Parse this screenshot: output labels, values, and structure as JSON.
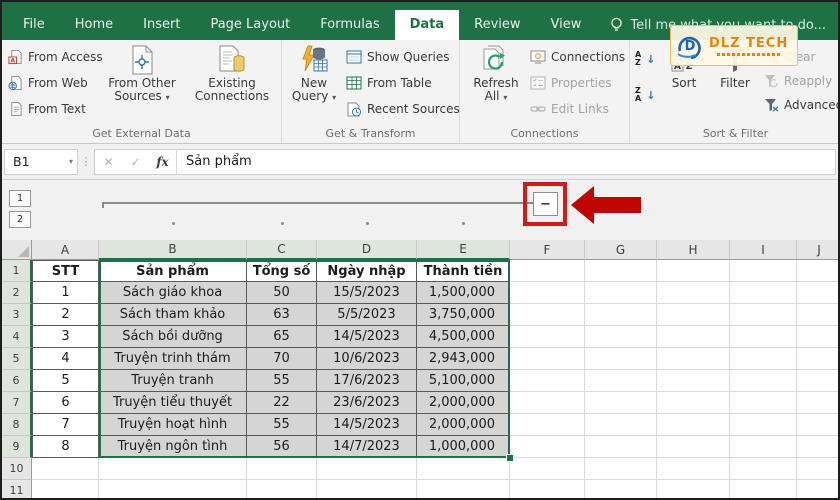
{
  "ribbon": {
    "tabs": [
      "File",
      "Home",
      "Insert",
      "Page Layout",
      "Formulas",
      "Data",
      "Review",
      "View"
    ],
    "active_tab": "Data",
    "tell_me": "Tell me what you want to do...",
    "group_labels": [
      "Get External Data",
      "Get & Transform",
      "Connections",
      "Sort & Filter"
    ],
    "buttons": {
      "from_access": "From Access",
      "from_web": "From Web",
      "from_text": "From Text",
      "from_other_sources": "From Other Sources",
      "existing_connections": "Existing Connections",
      "new_query": "New Query",
      "show_queries": "Show Queries",
      "from_table": "From Table",
      "recent_sources": "Recent Sources",
      "refresh_all": "Refresh All",
      "connections": "Connections",
      "properties": "Properties",
      "edit_links": "Edit Links",
      "sort": "Sort",
      "filter": "Filter",
      "clear": "Clear",
      "reapply": "Reapply",
      "advanced": "Advanced"
    }
  },
  "formula_bar": {
    "cell_ref": "B1",
    "formula": "Sản phẩm"
  },
  "icons": {
    "dropdown": "▾",
    "cancel": "✕",
    "enter": "✓",
    "fx": "fx",
    "more": "⋮",
    "collapse": "−",
    "sort_arrow": "↓"
  },
  "outline": {
    "level_buttons": [
      "1",
      "2"
    ]
  },
  "watermark": {
    "text": "DLZ TECH"
  },
  "sheet": {
    "column_headers": [
      "A",
      "B",
      "C",
      "D",
      "E",
      "F",
      "G",
      "H",
      "I",
      "J"
    ],
    "row_headers": [
      "1",
      "2",
      "3",
      "4",
      "5",
      "6",
      "7",
      "8",
      "9",
      "10",
      "11"
    ],
    "selection": {
      "active_cell": "B1",
      "range": "B1:E9"
    },
    "rows": [
      [
        "STT",
        "Sản phẩm",
        "Tổng số",
        "Ngày nhập",
        "Thành tiền"
      ],
      [
        "1",
        "Sách giáo khoa",
        "50",
        "15/5/2023",
        "1,500,000"
      ],
      [
        "2",
        "Sách tham khảo",
        "63",
        "5/5/2023",
        "3,750,000"
      ],
      [
        "3",
        "Sách bồi dưỡng",
        "65",
        "14/5/2023",
        "4,500,000"
      ],
      [
        "4",
        "Truyện trinh thám",
        "70",
        "10/6/2023",
        "2,943,000"
      ],
      [
        "5",
        "Truyện tranh",
        "55",
        "17/6/2023",
        "5,100,000"
      ],
      [
        "6",
        "Truyện tiểu thuyết",
        "22",
        "23/6/2023",
        "2,000,000"
      ],
      [
        "7",
        "Truyện hoạt hình",
        "55",
        "14/5/2023",
        "2,000,000"
      ],
      [
        "8",
        "Truyện ngôn tình",
        "56",
        "14/7/2023",
        "1,000,000"
      ]
    ]
  }
}
